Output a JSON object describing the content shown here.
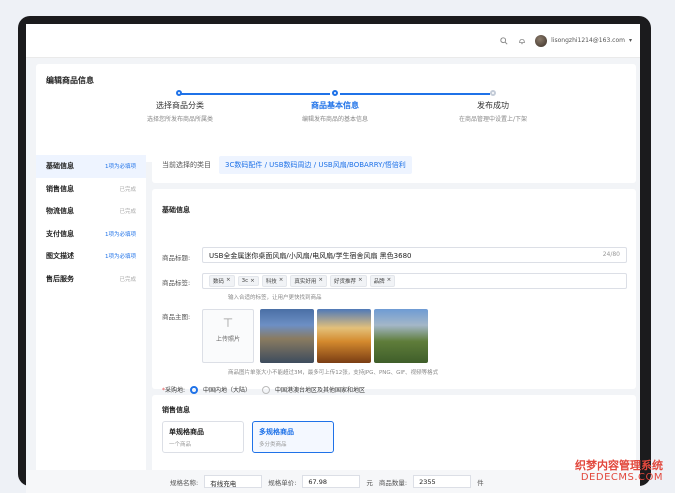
{
  "topbar": {
    "search_icon": "search-icon",
    "bell_icon": "bell-icon",
    "user_email": "lisongzhi1214@163.com"
  },
  "page_title": "编辑商品信息",
  "steps": [
    {
      "title": "选择商品分类",
      "sub": "选择您所发布商品所属类"
    },
    {
      "title": "商品基本信息",
      "sub": "编辑发布商品的基本信息"
    },
    {
      "title": "发布成功",
      "sub": "在商品管理中设置上/下架"
    }
  ],
  "sidebar": {
    "items": [
      {
        "label": "基础信息",
        "status": "1项为必填项"
      },
      {
        "label": "销售信息",
        "status": "已完成"
      },
      {
        "label": "物流信息",
        "status": "已完成"
      },
      {
        "label": "支付信息",
        "status": "1项为必填项"
      },
      {
        "label": "图文描述",
        "status": "1项为必填项"
      },
      {
        "label": "售后服务",
        "status": "已完成"
      }
    ]
  },
  "category": {
    "label": "当前选择的类目",
    "path": "3C数码配件 / USB数码周边 / USB风扇/BOBARRY/悟倍利"
  },
  "basic": {
    "section_title": "基础信息",
    "title_label": "商品标题:",
    "title_value": "USB全金属迷你桌面风扇/小风扇/电风扇/学生宿舍风扇 黑色3680",
    "title_counter": "24/80",
    "tags_label": "商品标签:",
    "tags": [
      "数码",
      "3c",
      "科技",
      "真实好用",
      "好货推荐",
      "品牌"
    ],
    "tags_hint": "输入合适的标签，让用户更快找到商品",
    "image_label": "商品主图:",
    "upload_label": "上传照片",
    "image_hint": "商品图片单张大小不能超过3M，最多可上传12张，支持JPG、PNG、GIF、视频等格式",
    "origin_label": "采购地:",
    "origin_options": [
      "中国内地（大陆）",
      "中国港澳台地区及其他国家和地区"
    ]
  },
  "sales": {
    "section_title": "销售信息",
    "options": [
      {
        "title": "单规格商品",
        "sub": "一个商品"
      },
      {
        "title": "多规格商品",
        "sub": "多分类商品"
      }
    ]
  },
  "bottom": {
    "spec_name_label": "规格名称:",
    "spec_name_value": "有线充电",
    "spec_price_label": "规格单价:",
    "spec_price_value": "67.98",
    "price_unit": "元",
    "qty_label": "商品数量:",
    "qty_value": "2355",
    "qty_unit": "件"
  },
  "watermark": {
    "line1": "织梦内容管理系统",
    "line2": "DEDECMS.COM"
  },
  "colors": {
    "accent": "#1f72e8",
    "required": "#e64a4a"
  }
}
